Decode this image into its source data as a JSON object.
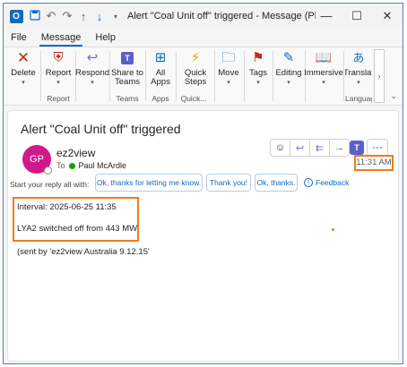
{
  "window": {
    "title": "Alert \"Coal Unit off\" triggered  -  Message (Plain T...",
    "app_icon": "outlook-icon",
    "qat": [
      "save-icon",
      "undo-icon",
      "redo-icon",
      "up-arrow-icon",
      "down-arrow-icon",
      "dropdown-icon"
    ],
    "controls": [
      "minimize-icon",
      "maximize-icon",
      "close-icon"
    ]
  },
  "menu": {
    "tabs": [
      "File",
      "Message",
      "Help"
    ],
    "active": "Message"
  },
  "ribbon": {
    "buttons": [
      {
        "label": "Delete",
        "icon": "delete-x-icon"
      },
      {
        "label": "Report",
        "icon": "report-shield-icon"
      },
      {
        "label": "Respond",
        "icon": "respond-icon"
      },
      {
        "label": "Share to Teams",
        "icon": "teams-share-icon"
      },
      {
        "label": "All Apps",
        "icon": "apps-grid-icon"
      },
      {
        "label": "Quick Steps",
        "icon": "lightning-icon"
      },
      {
        "label": "Move",
        "icon": "move-folder-icon"
      },
      {
        "label": "Tags",
        "icon": "tag-icon"
      },
      {
        "label": "Editing",
        "icon": "pencil-icon"
      },
      {
        "label": "Immersive",
        "icon": "immersive-reader-icon"
      },
      {
        "label": "Translat",
        "icon": "translate-icon"
      }
    ],
    "groups": [
      "Report",
      "Teams",
      "Apps",
      "Quick...",
      "Languag"
    ]
  },
  "message": {
    "subject": "Alert \"Coal Unit off\" triggered",
    "avatar_initials": "GP",
    "avatar_color": "#d0188a",
    "sender": "ez2view",
    "to_label": "To",
    "to_name": "Paul McArdle",
    "time": "11:31 AM",
    "reply_prompt": "Start your reply all with:",
    "suggested_replies": [
      "Ok, thanks for letting me know.",
      "Thank you!",
      "Ok, thanks."
    ],
    "feedback": "Feedback",
    "body": {
      "interval": "Interval: 2025-06-25 11:35",
      "status": "LYA2 switched off from 443 MW",
      "footer": "(sent by 'ez2view Australia 9.12.15'"
    }
  },
  "colors": {
    "accent": "#0f6cbd",
    "highlight": "#f07b1b",
    "teams": "#5b5fc7"
  }
}
